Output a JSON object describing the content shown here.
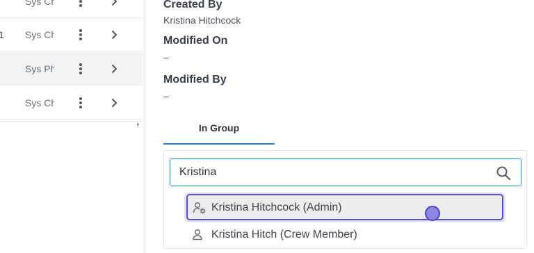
{
  "list": {
    "rows": [
      {
        "id": "",
        "name": "Sys Ch"
      },
      {
        "id": "1",
        "name": "Sys Ch"
      },
      {
        "id": "",
        "name": "Sys Ph"
      },
      {
        "id": "",
        "name": "Sys Ch"
      }
    ]
  },
  "details": {
    "created_by_label": "Created By",
    "created_by_value": "Kristina Hitchcock",
    "modified_on_label": "Modified On",
    "modified_on_value": "–",
    "modified_by_label": "Modified By",
    "modified_by_value": "–"
  },
  "tabs": {
    "in_group": "In Group"
  },
  "group_search": {
    "value": "Kristina",
    "options": [
      {
        "label": "Kristina Hitchcock (Admin)",
        "icon": "user-gear-icon",
        "selected": true
      },
      {
        "label": "Kristina Hitch (Crew Member)",
        "icon": "user-icon",
        "selected": false
      }
    ]
  },
  "colors": {
    "accent": "#2b7fc4",
    "selection_border": "#5a4fcf"
  }
}
